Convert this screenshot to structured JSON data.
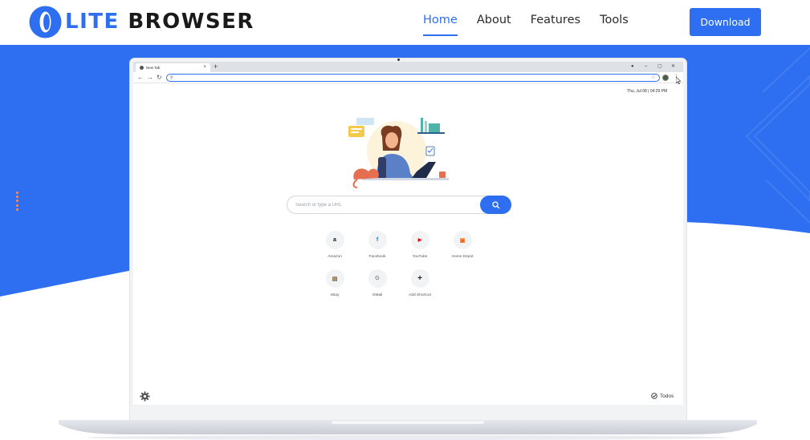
{
  "header": {
    "logo_text_lite": "LITE",
    "logo_text_browser": "BROWSER",
    "nav": [
      "Home",
      "About",
      "Features",
      "Tools"
    ],
    "active_nav": "Home",
    "download_label": "Download"
  },
  "colors": {
    "brand_blue": "#2d6ff0",
    "accent_orange": "#ff8c5a"
  },
  "browser": {
    "tab_title": "New Tab",
    "tab_close": "×",
    "new_tab": "+",
    "win_min": "–",
    "win_max": "▢",
    "win_close": "✕",
    "back": "←",
    "forward": "→",
    "reload": "↻",
    "menu": "⋮",
    "datetime": "Thu, Jul 08  |  04:29 PM"
  },
  "newtab": {
    "search_placeholder": "Search or type a URL",
    "shortcuts": [
      {
        "label": "Amazon",
        "glyph": "a",
        "color": "#111111",
        "icon": "amazon-icon"
      },
      {
        "label": "Facebook",
        "glyph": "f",
        "color": "#1877f2",
        "icon": "facebook-icon"
      },
      {
        "label": "YouTube",
        "glyph": "▶",
        "color": "#ff0000",
        "icon": "youtube-icon"
      },
      {
        "label": "Home Depot",
        "glyph": "▣",
        "color": "#f96302",
        "icon": "home-depot-icon"
      },
      {
        "label": "eBay",
        "glyph": "▤",
        "color": "#7a5c2e",
        "icon": "ebay-icon"
      },
      {
        "label": "GMail",
        "glyph": "G",
        "color": "#888888",
        "icon": "gmail-icon"
      },
      {
        "label": "Add Shortcut",
        "glyph": "+",
        "color": "#222222",
        "icon": "add-shortcut-icon"
      }
    ],
    "todos_label": "Todos"
  }
}
